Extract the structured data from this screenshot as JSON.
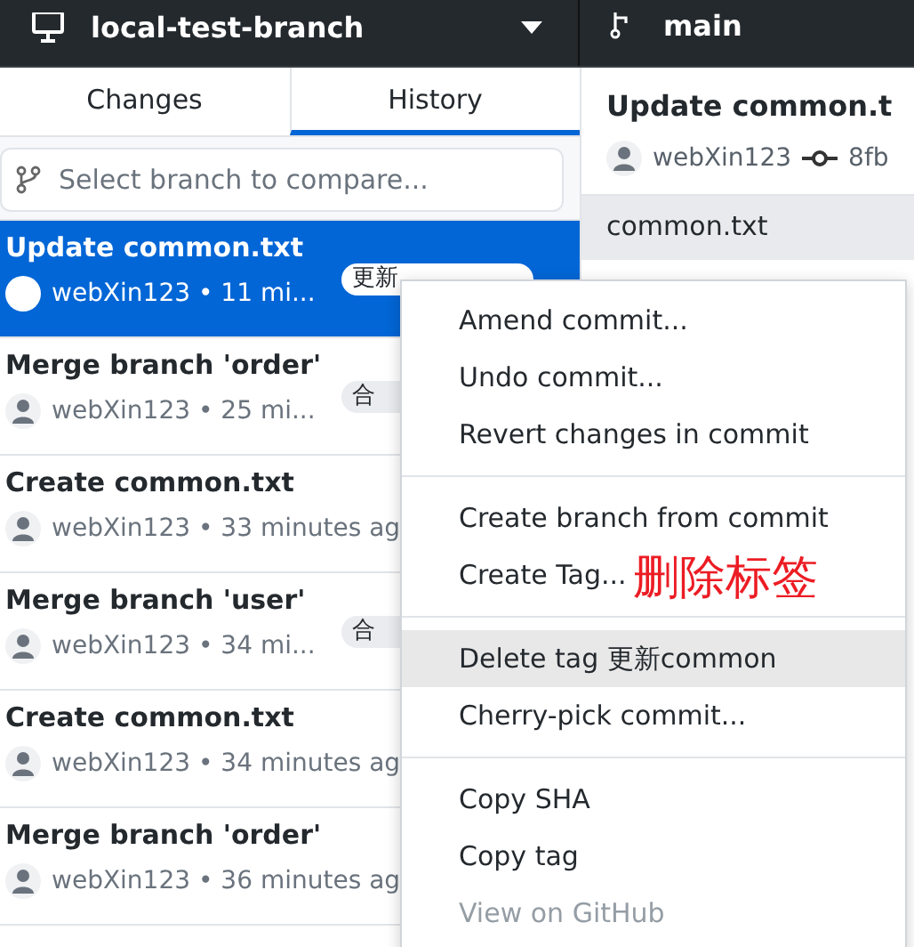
{
  "toolbar": {
    "branch": "local-test-branch",
    "right_branch": "main"
  },
  "tabs": [
    {
      "label": "Changes",
      "selected": false
    },
    {
      "label": "History",
      "selected": true
    }
  ],
  "branch_filter": {
    "placeholder": "Select branch to compare..."
  },
  "commits": [
    {
      "title": "Update common.txt",
      "meta": "webXin123 • 11 mi...",
      "tag": "更新",
      "selected": true
    },
    {
      "title": "Merge branch 'order'",
      "meta": "webXin123 • 25 mi...",
      "tag": "合",
      "selected": false
    },
    {
      "title": "Create common.txt",
      "meta": "webXin123 • 33 minutes ag",
      "selected": false
    },
    {
      "title": "Merge branch 'user'",
      "meta": "webXin123 • 34 mi...",
      "tag": "合",
      "selected": false
    },
    {
      "title": "Create common.txt",
      "meta": "webXin123 • 34 minutes ag",
      "selected": false
    },
    {
      "title": "Merge branch 'order'",
      "meta": "webXin123 • 36 minutes ag",
      "selected": false
    }
  ],
  "detail": {
    "title": "Update common.t",
    "author": "webXin123",
    "sha": "8fb",
    "file": "common.txt"
  },
  "context_menu": [
    {
      "kind": "item",
      "label": "Amend commit...",
      "selected": false,
      "disabled": false
    },
    {
      "kind": "item",
      "label": "Undo commit...",
      "selected": false,
      "disabled": false
    },
    {
      "kind": "item",
      "label": "Revert changes in commit",
      "selected": false,
      "disabled": false
    },
    {
      "kind": "separator"
    },
    {
      "kind": "item",
      "label": "Create branch from commit",
      "selected": false,
      "disabled": false
    },
    {
      "kind": "item",
      "label": "Create Tag...",
      "selected": false,
      "disabled": false
    },
    {
      "kind": "separator"
    },
    {
      "kind": "item",
      "label": "Delete tag 更新common",
      "selected": true,
      "disabled": false
    },
    {
      "kind": "item",
      "label": "Cherry-pick commit...",
      "selected": false,
      "disabled": false
    },
    {
      "kind": "separator"
    },
    {
      "kind": "item",
      "label": "Copy SHA",
      "selected": false,
      "disabled": false
    },
    {
      "kind": "item",
      "label": "Copy tag",
      "selected": false,
      "disabled": false
    },
    {
      "kind": "item",
      "label": "View on GitHub",
      "selected": false,
      "disabled": true
    }
  ],
  "annotation": "删除标签"
}
